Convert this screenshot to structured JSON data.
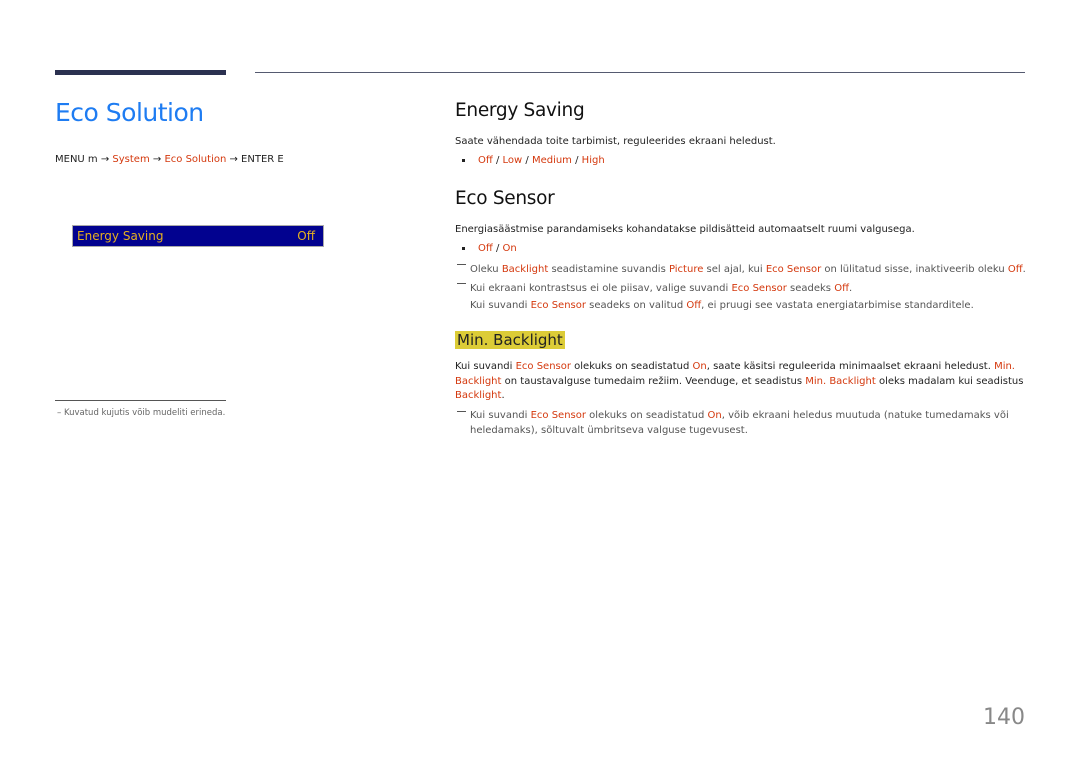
{
  "left": {
    "title": "Eco Solution",
    "path": {
      "menu": "MENU m → ",
      "system": "System",
      "arrow1": " → ",
      "eco": "Eco Solution",
      "arrow2": " → ENTER E"
    },
    "menu_item": {
      "label": "Energy Saving",
      "value": "Off"
    },
    "footnote": "–  Kuvatud kujutis võib mudeliti erineda."
  },
  "energy_saving": {
    "heading": "Energy Saving",
    "desc": "Saate vähendada toite tarbimist, reguleerides ekraani heledust.",
    "options": [
      "Off",
      "Low",
      "Medium",
      "High"
    ],
    "sep": " / "
  },
  "eco_sensor": {
    "heading": "Eco Sensor",
    "desc": "Energiasäästmise parandamiseks kohandatakse pildisätteid automaatselt ruumi valgusega.",
    "options": [
      "Off",
      "On"
    ],
    "sep": " / ",
    "note1": {
      "t1": "Oleku ",
      "r1": "Backlight",
      "t2": " seadistamine suvandis ",
      "r2": "Picture",
      "t3": " sel ajal, kui ",
      "r3": "Eco Sensor",
      "t4": " on lülitatud sisse, inaktiveerib oleku ",
      "r4": "Off",
      "t5": "."
    },
    "note2": {
      "t1": "Kui ekraani kontrastsus ei ole piisav, valige suvandi ",
      "r1": "Eco Sensor",
      "t2": " seadeks ",
      "r2": "Off",
      "t3": ".",
      "l2t1": "Kui suvandi ",
      "l2r1": "Eco Sensor",
      "l2t2": " seadeks on valitud ",
      "l2r2": "Off",
      "l2t3": ", ei pruugi see vastata energiatarbimise standarditele."
    }
  },
  "min_backlight": {
    "heading": "Min. Backlight",
    "p": {
      "t1": "Kui suvandi ",
      "r1": "Eco Sensor",
      "t2": " olekuks on seadistatud ",
      "r2": "On",
      "t3": ", saate käsitsi reguleerida minimaalset ekraani heledust. ",
      "r3": "Min. Backlight",
      "t4": " on taustavalguse tumedaim režiim. Veenduge, et seadistus ",
      "r4": "Min. Backlight",
      "t5": " oleks madalam kui seadistus ",
      "r5": "Backlight",
      "t6": "."
    },
    "note": {
      "t1": "Kui suvandi ",
      "r1": "Eco Sensor",
      "t2": " olekuks on seadistatud ",
      "r2": "On",
      "t3": ", võib ekraani heledus muutuda (natuke tumedamaks või heledamaks), sõltuvalt ümbritseva valguse tugevusest."
    }
  },
  "page_number": "140"
}
